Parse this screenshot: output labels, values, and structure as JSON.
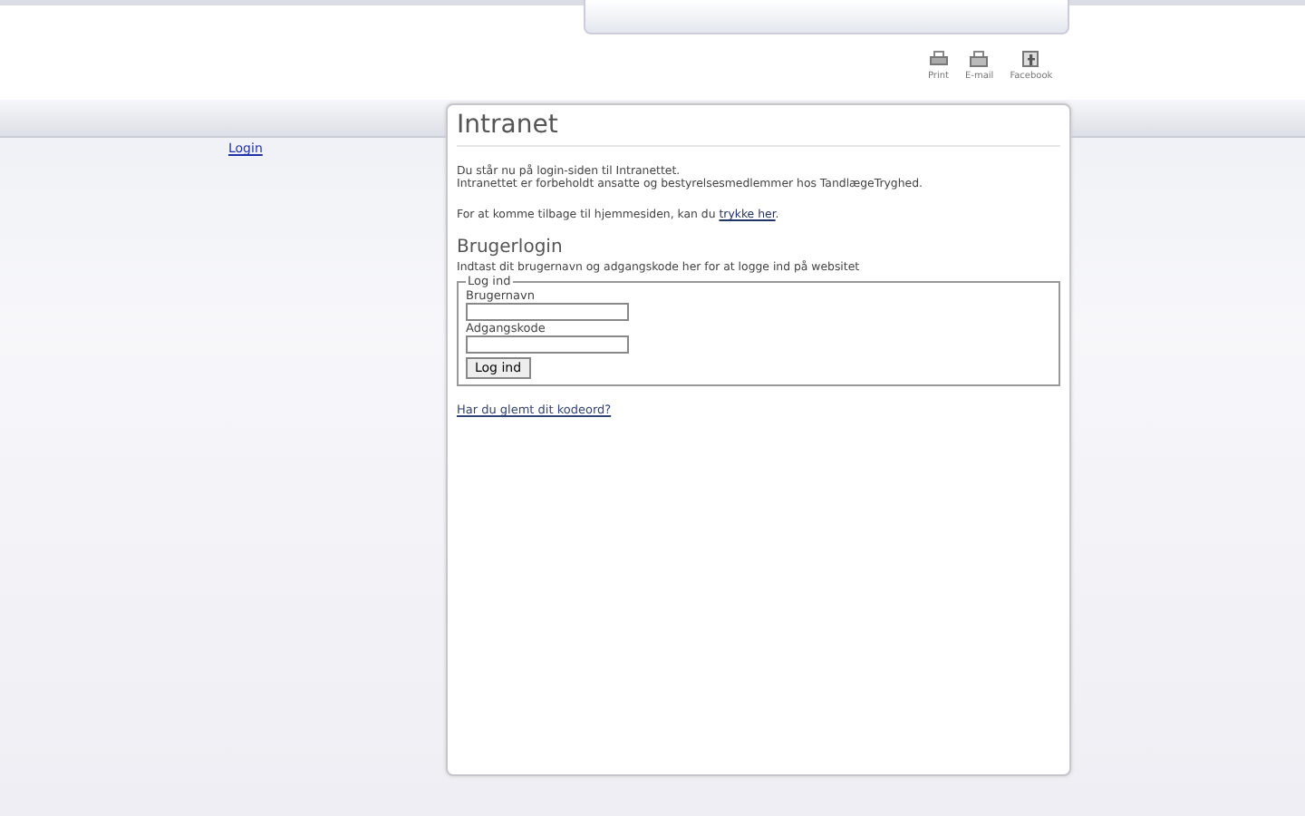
{
  "toolbar": [
    {
      "kind": "print",
      "label": "Print"
    },
    {
      "kind": "email",
      "label": "E-mail"
    },
    {
      "kind": "facebook",
      "label": "Facebook"
    }
  ],
  "nav_link": "Login",
  "card": {
    "title": "Intranet",
    "intro": [
      "Du står nu på login-siden til Intranettet.",
      "Intranettet er forbeholdt ansatte og bestyrelsesmedlemmer hos TandlægeTryghed."
    ],
    "back_text": "For at komme tilbage til hjemmesiden, kan du ",
    "back_link": "trykke her",
    "back_end": ".",
    "login_heading": "Brugerlogin",
    "login_intro": "Indtast dit brugernavn og adgangskode her for at logge ind på websitet",
    "fieldset_legend": "Log ind",
    "fields": [
      {
        "label": "Brugernavn"
      },
      {
        "label": "Adgangskode"
      }
    ],
    "submit": "Log ind",
    "forgot": "Har du glemt dit kodeord?"
  }
}
